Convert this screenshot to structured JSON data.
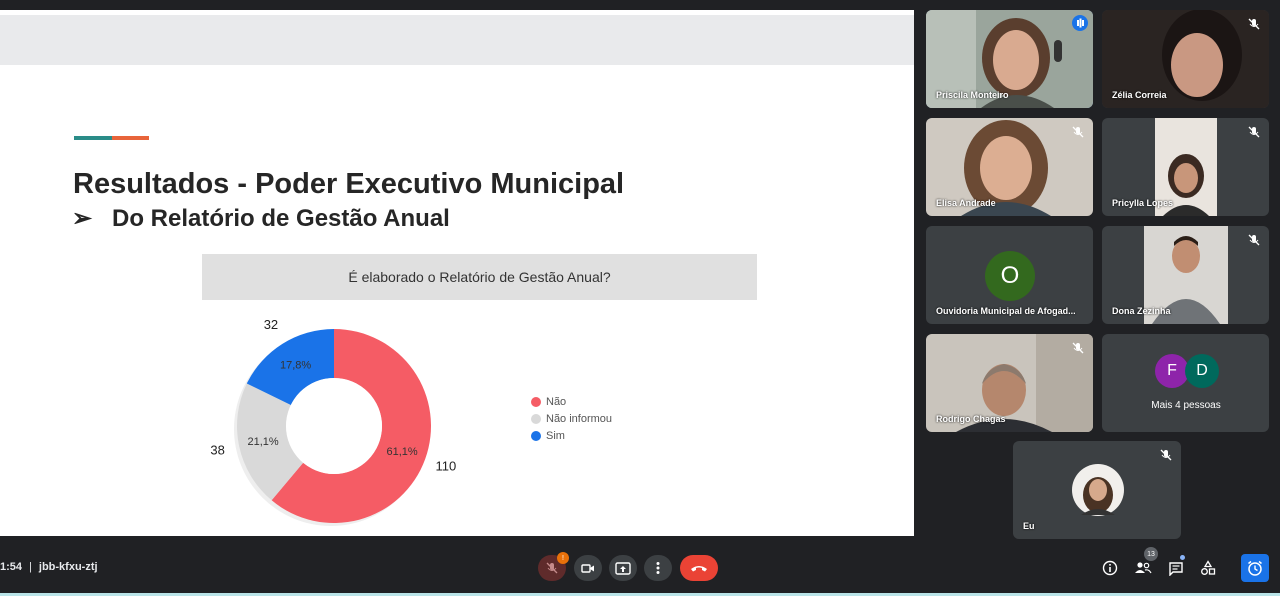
{
  "slide": {
    "title": "Resultados - Poder Executivo Municipal",
    "subtitle_arrow": "➢",
    "subtitle": "Do Relatório de Gestão Anual",
    "question": "É elaborado o Relatório de Gestão Anual?",
    "accent_colors": [
      "#2a8c88",
      "#e8643a"
    ]
  },
  "chart_data": {
    "type": "pie",
    "title": "É elaborado o Relatório de Gestão Anual?",
    "categories": [
      "Não",
      "Não informou",
      "Sim"
    ],
    "values": [
      110,
      38,
      32
    ],
    "percent_labels": [
      "61,1%",
      "21,1%",
      "17,8%"
    ],
    "count_labels": [
      "110",
      "38",
      "32"
    ],
    "colors": [
      "#f55c65",
      "#d9d9d9",
      "#1a73e8"
    ],
    "donut": true,
    "legend_position": "right"
  },
  "participants": [
    {
      "name": "Priscila Monteiro",
      "speaking": true
    },
    {
      "name": "Zélia Correia",
      "muted": true
    },
    {
      "name": "Elisa Andrade",
      "muted": true
    },
    {
      "name": "Pricylla Lopes",
      "muted": true
    },
    {
      "name": "Ouvidoria Municipal de Afogad...",
      "avatar_letter": "O",
      "avatar_color": "#33691e"
    },
    {
      "name": "Dona Zezinha",
      "muted": true
    },
    {
      "name": "Rodrigo Chagas",
      "muted": true
    },
    {
      "more": {
        "letters": [
          "F",
          "D"
        ],
        "colors": [
          "#8e24aa",
          "#00695c"
        ],
        "label": "Mais 4 pessoas"
      }
    },
    {
      "name": "Eu",
      "muted": true
    }
  ],
  "bottom_bar": {
    "time": "1:54",
    "separator": "|",
    "meeting_code": "jbb-kfxu-ztj",
    "mic_badge": "!",
    "people_count": "13",
    "end_call_color": "#ea4335",
    "active_button_color": "#1a73e8"
  }
}
